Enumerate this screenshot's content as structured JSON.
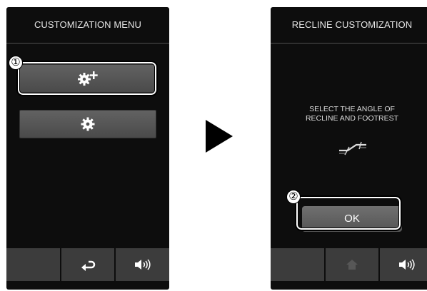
{
  "left_screen": {
    "title": "CUSTOMIZATION MENU",
    "buttons": [
      {
        "icon": "gear-plus-icon"
      },
      {
        "icon": "gear-icon"
      }
    ],
    "footer": [
      {
        "icon": "blank"
      },
      {
        "icon": "return-arrow-icon"
      },
      {
        "icon": "speaker-icon"
      }
    ],
    "callout_number": "①"
  },
  "right_screen": {
    "title": "RECLINE CUSTOMIZATION",
    "instruction_line1": "SELECT THE ANGLE OF",
    "instruction_line2": "RECLINE AND FOOTREST",
    "recline_icon": "recline-angle-icon",
    "ok_label": "OK",
    "footer": [
      {
        "icon": "blank"
      },
      {
        "icon": "home-icon"
      },
      {
        "icon": "speaker-icon"
      }
    ],
    "callout_number": "②"
  },
  "arrow_icon": "play-arrow-icon",
  "colors": {
    "screen_bg": "#0d0d0d",
    "button": "#555555",
    "footer": "#3c3c3c",
    "text": "#e6e6e6"
  }
}
